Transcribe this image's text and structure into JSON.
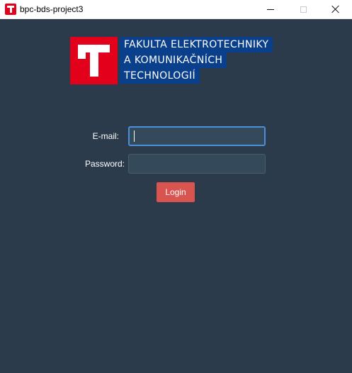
{
  "window": {
    "title": "bpc-bds-project3"
  },
  "logo": {
    "lines": [
      "FAKULTA ELEKTROTECHNIKY",
      "A KOMUNIKAČNÍCH",
      "TECHNOLOGIÍ"
    ]
  },
  "form": {
    "email": {
      "label": "E-mail:",
      "value": "",
      "placeholder": ""
    },
    "password": {
      "label": "Password:",
      "value": "",
      "placeholder": ""
    },
    "login_label": "Login"
  },
  "colors": {
    "background": "#2b3b4b",
    "brand_red": "#e2001a",
    "brand_blue": "#0a3f8c",
    "login_button": "#d9534f",
    "focus_border": "#4a90d9"
  }
}
